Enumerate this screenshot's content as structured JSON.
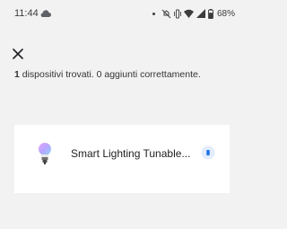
{
  "status_bar": {
    "time": "11:44",
    "battery_percent": "68%"
  },
  "summary": {
    "count": "1",
    "text": " dispositivi trovati. 0 aggiunti correttamente."
  },
  "device": {
    "name": "Smart Lighting Tunable..."
  },
  "colors": {
    "accent": "#1a73e8",
    "background": "#f2f2f2",
    "card": "#ffffff"
  },
  "icons": [
    "cloud-icon",
    "do-not-disturb-icon",
    "vibrate-icon",
    "wifi-icon",
    "signal-icon",
    "battery-icon",
    "close-icon",
    "bulb-icon",
    "pending-status-icon"
  ]
}
